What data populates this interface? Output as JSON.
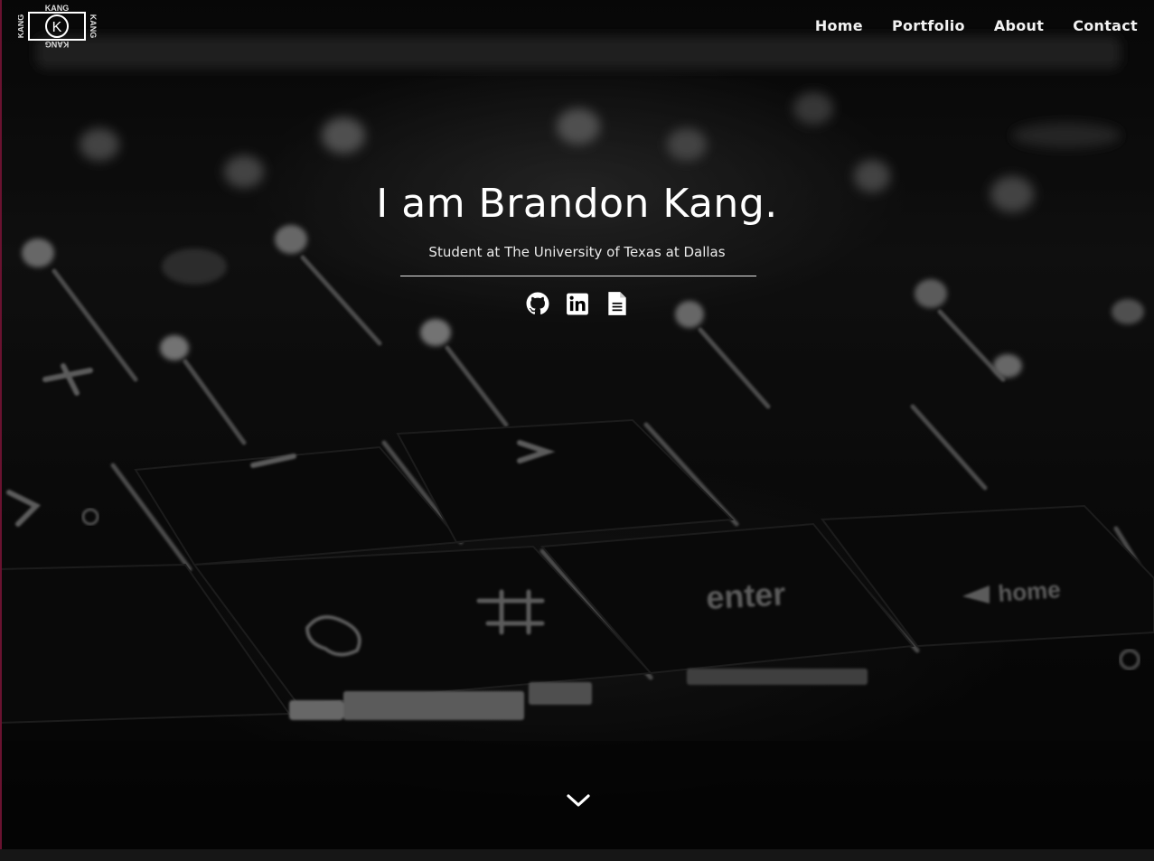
{
  "logo": {
    "alt": "KANG logo",
    "text": "KANG",
    "letter": "K",
    "icon": "kang-logo-icon"
  },
  "nav": {
    "items": [
      {
        "label": "Home"
      },
      {
        "label": "Portfolio"
      },
      {
        "label": "About"
      },
      {
        "label": "Contact"
      }
    ]
  },
  "hero": {
    "title": "I am Brandon Kang.",
    "subtitle": "Student at The University of Texas at Dallas",
    "background": "dark keyboard photo",
    "social": [
      {
        "name": "GitHub",
        "icon": "github-icon"
      },
      {
        "name": "LinkedIn",
        "icon": "linkedin-icon"
      },
      {
        "name": "Resume",
        "icon": "document-icon"
      }
    ],
    "scroll_icon": "chevron-down-icon",
    "keyboard_labels": {
      "enter": "enter",
      "home": "home"
    }
  },
  "colors": {
    "text": "#ffffff",
    "background": "#000000",
    "accent_edge": "#6a1230"
  }
}
